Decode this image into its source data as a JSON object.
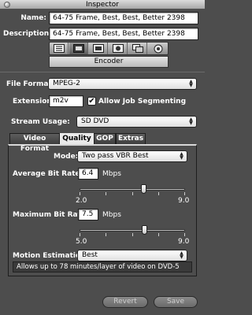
{
  "window": {
    "title": "Inspector"
  },
  "name": {
    "label": "Name:",
    "value": "64-75 Frame, Best, Best, Better 2398"
  },
  "description": {
    "label": "Description:",
    "value": "64-75 Frame, Best, Best, Better 2398"
  },
  "toolbar": {
    "icons": [
      "summary-icon",
      "encoder-icon",
      "frame-controls-icon",
      "filters-icon",
      "geometry-icon",
      "actions-icon"
    ],
    "active_label": "Encoder"
  },
  "file_format": {
    "label": "File Format:",
    "value": "MPEG-2"
  },
  "extension": {
    "label": "Extension:",
    "value": "m2v"
  },
  "job_segmenting": {
    "label": "Allow Job Segmenting",
    "checked": true
  },
  "stream_usage": {
    "label": "Stream Usage:",
    "value": "SD DVD"
  },
  "tabs": [
    {
      "label": "Video Format",
      "active": false
    },
    {
      "label": "Quality",
      "active": true
    },
    {
      "label": "GOP",
      "active": false
    },
    {
      "label": "Extras",
      "active": false
    }
  ],
  "mode": {
    "label": "Mode:",
    "value": "Two pass VBR Best"
  },
  "avg_bitrate": {
    "label": "Average Bit Rate:",
    "value": "6.4",
    "unit": "Mbps",
    "min": "2.0",
    "max": "9.0"
  },
  "max_bitrate": {
    "label": "Maximum Bit Rate:",
    "value": "7.5",
    "unit": "Mbps",
    "min": "5.0",
    "max": "9.0"
  },
  "motion_estimation": {
    "label": "Motion Estimation:",
    "value": "Best"
  },
  "info_text": "Allows up to 78 minutes/layer of video on DVD-5",
  "buttons": {
    "revert": "Revert",
    "save": "Save"
  }
}
